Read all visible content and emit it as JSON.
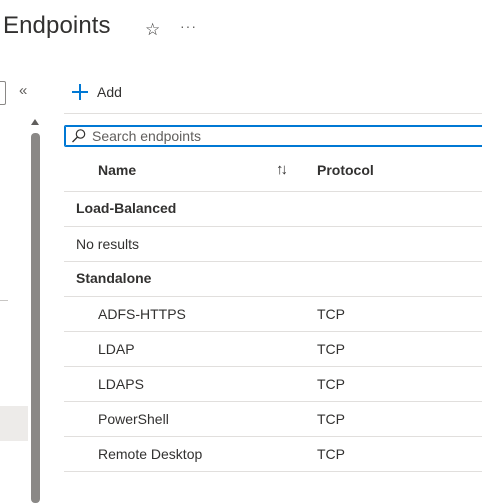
{
  "header": {
    "title": "Endpoints",
    "star_icon": "star-outline-icon",
    "more_icon": "more-horizontal-icon"
  },
  "sidebar": {
    "collapse_icon": "double-chevron-left-icon"
  },
  "toolbar": {
    "add_label": "Add"
  },
  "search": {
    "placeholder": "Search endpoints",
    "value": ""
  },
  "table": {
    "columns": {
      "name": "Name",
      "protocol": "Protocol"
    },
    "groups": [
      {
        "label": "Load-Balanced",
        "empty_text": "No results",
        "rows": []
      },
      {
        "label": "Standalone",
        "rows": [
          {
            "name": "ADFS-HTTPS",
            "protocol": "TCP"
          },
          {
            "name": "LDAP",
            "protocol": "TCP"
          },
          {
            "name": "LDAPS",
            "protocol": "TCP"
          },
          {
            "name": "PowerShell",
            "protocol": "TCP"
          },
          {
            "name": "Remote Desktop",
            "protocol": "TCP"
          }
        ]
      }
    ]
  },
  "colors": {
    "accent": "#0078d4",
    "text": "#323130",
    "divider": "#e1dfdd"
  }
}
